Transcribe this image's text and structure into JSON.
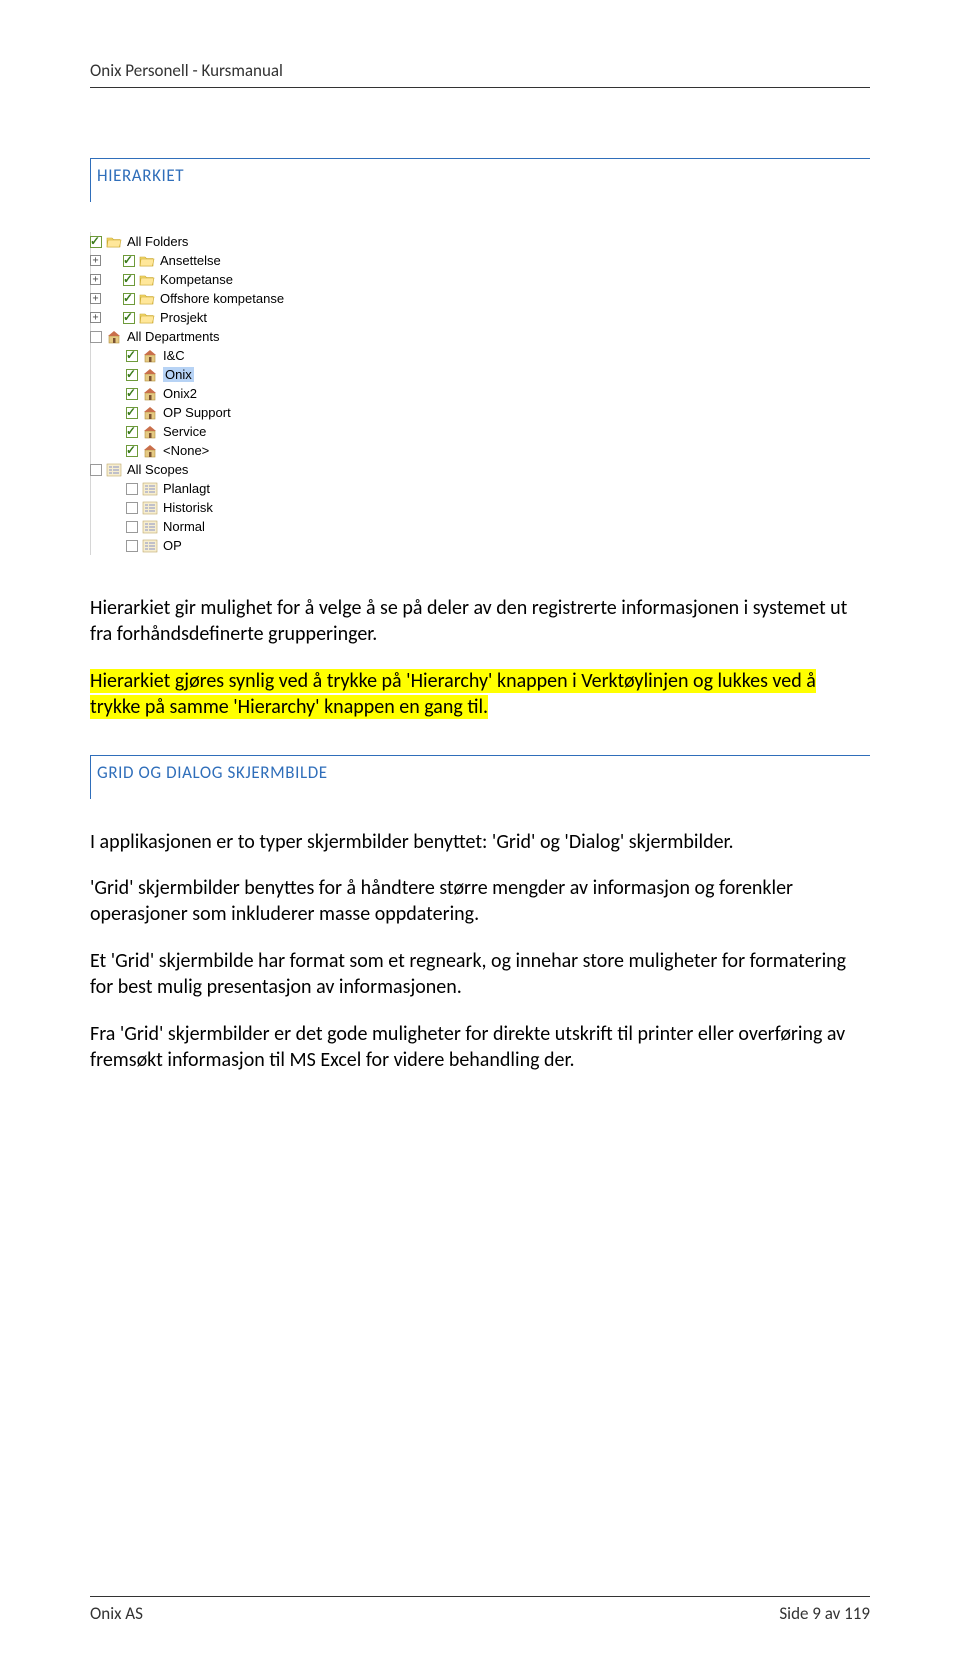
{
  "header": {
    "title": "Onix Personell - Kursmanual"
  },
  "section1_heading": "HIERARKIET",
  "tree": {
    "nodes": [
      {
        "indent": 0,
        "expand": "",
        "checked": true,
        "icon": "folder",
        "label": "All Folders"
      },
      {
        "indent": 1,
        "expand": "+",
        "checked": true,
        "icon": "folder",
        "label": "Ansettelse"
      },
      {
        "indent": 1,
        "expand": "+",
        "checked": true,
        "icon": "folder",
        "label": "Kompetanse"
      },
      {
        "indent": 1,
        "expand": "+",
        "checked": true,
        "icon": "folder",
        "label": "Offshore kompetanse"
      },
      {
        "indent": 1,
        "expand": "+",
        "checked": true,
        "icon": "folder",
        "label": "Prosjekt"
      },
      {
        "indent": 0,
        "expand": "",
        "checked": false,
        "icon": "house",
        "label": "All Departments",
        "gray": true
      },
      {
        "indent": 2,
        "expand": "",
        "checked": true,
        "icon": "house",
        "label": "I&C"
      },
      {
        "indent": 2,
        "expand": "",
        "checked": true,
        "icon": "house",
        "label": "Onix",
        "selected": true
      },
      {
        "indent": 2,
        "expand": "",
        "checked": true,
        "icon": "house",
        "label": "Onix2"
      },
      {
        "indent": 2,
        "expand": "",
        "checked": true,
        "icon": "house",
        "label": "OP Support"
      },
      {
        "indent": 2,
        "expand": "",
        "checked": true,
        "icon": "house",
        "label": "Service"
      },
      {
        "indent": 2,
        "expand": "",
        "checked": true,
        "icon": "house",
        "label": "<None>"
      },
      {
        "indent": 0,
        "expand": "",
        "checked": false,
        "icon": "list",
        "label": "All Scopes",
        "gray": true
      },
      {
        "indent": 2,
        "expand": "",
        "checked": false,
        "icon": "list",
        "label": "Planlagt",
        "gray": true
      },
      {
        "indent": 2,
        "expand": "",
        "checked": false,
        "icon": "list",
        "label": "Historisk",
        "gray": true
      },
      {
        "indent": 2,
        "expand": "",
        "checked": false,
        "icon": "list",
        "label": "Normal",
        "gray": true
      },
      {
        "indent": 2,
        "expand": "",
        "checked": false,
        "icon": "list",
        "label": "OP",
        "gray": true
      }
    ]
  },
  "para1": "Hierarkiet gir mulighet for å velge å se på deler av den registrerte informasjonen i systemet ut fra forhåndsdefinerte grupperinger.",
  "para2_hl": "Hierarkiet gjøres synlig ved å trykke på 'Hierarchy' knappen i Verktøylinjen og lukkes ved å trykke på samme 'Hierarchy' knappen en gang til.",
  "section2_heading": "GRID OG DIALOG SKJERMBILDE",
  "para3": "I applikasjonen er to typer skjermbilder benyttet: 'Grid' og 'Dialog' skjermbilder.",
  "para4": "'Grid' skjermbilder benyttes for å håndtere større mengder av informasjon og forenkler operasjoner som inkluderer masse oppdatering.",
  "para5": "Et 'Grid' skjermbilde har format som et regneark, og innehar store muligheter for formatering for best mulig presentasjon av informasjonen.",
  "para6": "Fra 'Grid' skjermbilder er det gode muligheter for direkte utskrift til printer eller overføring av fremsøkt informasjon til MS Excel for videre behandling der.",
  "footer": {
    "left": "Onix AS",
    "right": "Side 9 av 119"
  }
}
